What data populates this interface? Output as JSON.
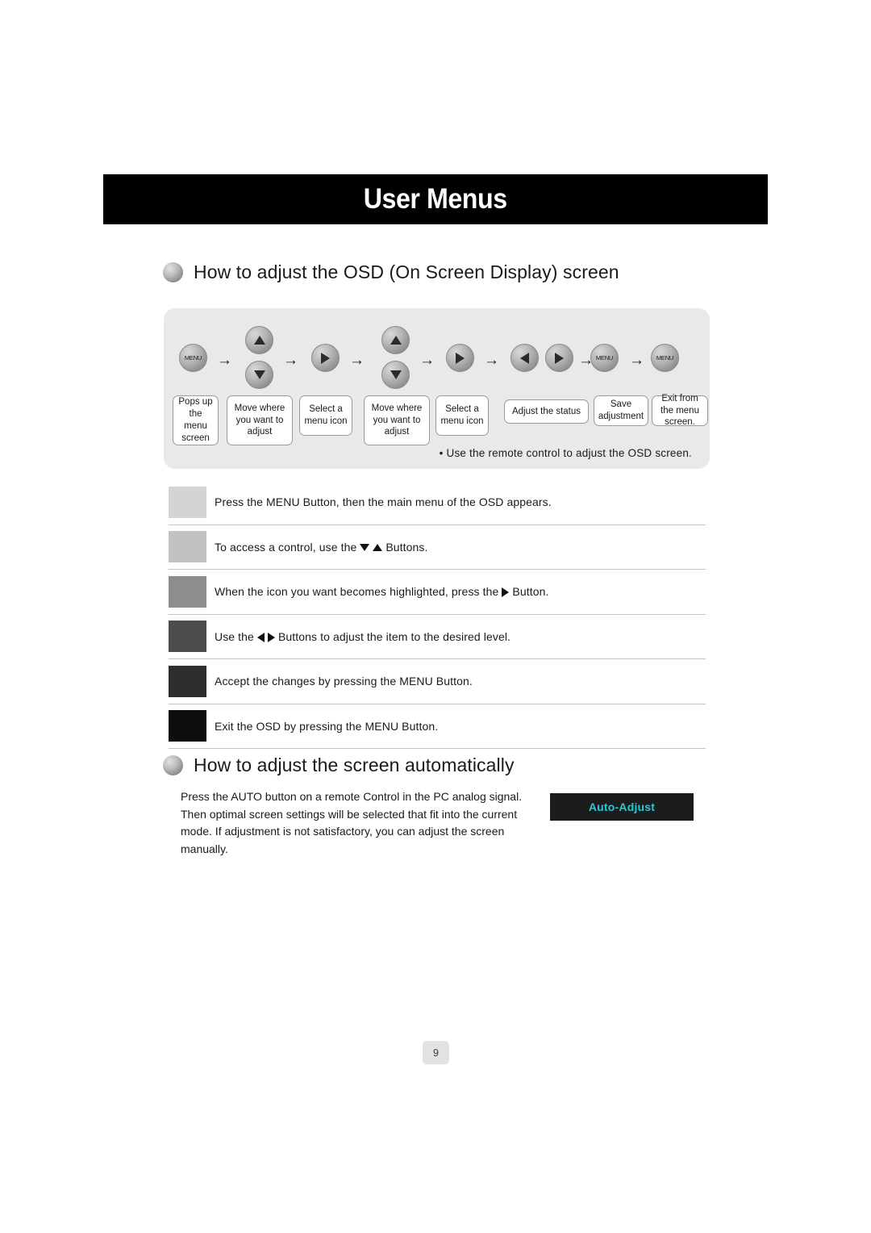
{
  "header": {
    "title": "User Menus"
  },
  "sections": {
    "osd": {
      "heading": "How to adjust the OSD (On Screen Display) screen",
      "note": "• Use the remote control to adjust the OSD screen."
    },
    "auto": {
      "heading": "How to adjust the screen automatically",
      "body": "Press the AUTO button on a remote Control in the PC analog signal. Then optimal screen settings will be selected that fit into the current mode. If adjustment is not satisfactory, you can adjust the screen manually.",
      "chip_label": "Auto-Adjust"
    }
  },
  "diagram": {
    "buttons": [
      {
        "id": "menu-1",
        "icon": "menu-button-icon",
        "label": "MENU"
      },
      {
        "id": "up-1",
        "icon": "triangle-up-icon",
        "label": ""
      },
      {
        "id": "down-1",
        "icon": "triangle-down-icon",
        "label": ""
      },
      {
        "id": "right-1",
        "icon": "triangle-right-icon",
        "label": ""
      },
      {
        "id": "up-2",
        "icon": "triangle-up-icon",
        "label": ""
      },
      {
        "id": "down-2",
        "icon": "triangle-down-icon",
        "label": ""
      },
      {
        "id": "right-2",
        "icon": "triangle-right-icon",
        "label": ""
      },
      {
        "id": "left-3",
        "icon": "triangle-left-icon",
        "label": ""
      },
      {
        "id": "right-3",
        "icon": "triangle-right-icon",
        "label": ""
      },
      {
        "id": "menu-2",
        "icon": "menu-button-icon",
        "label": "MENU"
      },
      {
        "id": "menu-3",
        "icon": "menu-button-icon",
        "label": "MENU"
      }
    ],
    "callouts": [
      {
        "id": "callout-1",
        "text": "Pops up the menu screen"
      },
      {
        "id": "callout-2",
        "text": "Move where you want to adjust"
      },
      {
        "id": "callout-3",
        "text": "Select a menu icon"
      },
      {
        "id": "callout-4",
        "text": "Move where you want to adjust"
      },
      {
        "id": "callout-5",
        "text": "Select a menu icon"
      },
      {
        "id": "callout-6",
        "text": "Adjust the status"
      },
      {
        "id": "callout-7",
        "text": "Save adjustment"
      },
      {
        "id": "callout-8",
        "text": "Exit from the menu screen."
      }
    ],
    "arrow_glyph": "→"
  },
  "steps": [
    {
      "swatch": "#d4d4d4",
      "parts": [
        {
          "type": "text",
          "value": "Press the MENU Button, then the main menu of the OSD appears."
        }
      ]
    },
    {
      "swatch": "#c2c2c2",
      "parts": [
        {
          "type": "text",
          "value": "To access a control, use the"
        },
        {
          "type": "icon",
          "value": "triangle-down-icon"
        },
        {
          "type": "icon",
          "value": "triangle-up-icon"
        },
        {
          "type": "text",
          "value": "Buttons."
        }
      ]
    },
    {
      "swatch": "#8d8d8d",
      "parts": [
        {
          "type": "text",
          "value": "When the icon you want becomes highlighted, press the"
        },
        {
          "type": "icon",
          "value": "triangle-right-icon"
        },
        {
          "type": "text",
          "value": "Button."
        }
      ]
    },
    {
      "swatch": "#4c4c4c",
      "parts": [
        {
          "type": "text",
          "value": "Use the"
        },
        {
          "type": "icon",
          "value": "triangle-left-icon"
        },
        {
          "type": "icon",
          "value": "triangle-right-icon"
        },
        {
          "type": "text",
          "value": "Buttons to adjust the item to the desired level."
        }
      ]
    },
    {
      "swatch": "#2e2e2e",
      "parts": [
        {
          "type": "text",
          "value": "Accept the changes by pressing the MENU Button."
        }
      ]
    },
    {
      "swatch": "#0d0d0d",
      "parts": [
        {
          "type": "text",
          "value": "Exit the OSD by pressing the MENU Button."
        }
      ]
    }
  ],
  "footer": {
    "page_number": "9"
  },
  "colors": {
    "accent_cyan": "#29c8d6",
    "title_bar": "#000000",
    "panel_bg": "#e9e9e9"
  }
}
